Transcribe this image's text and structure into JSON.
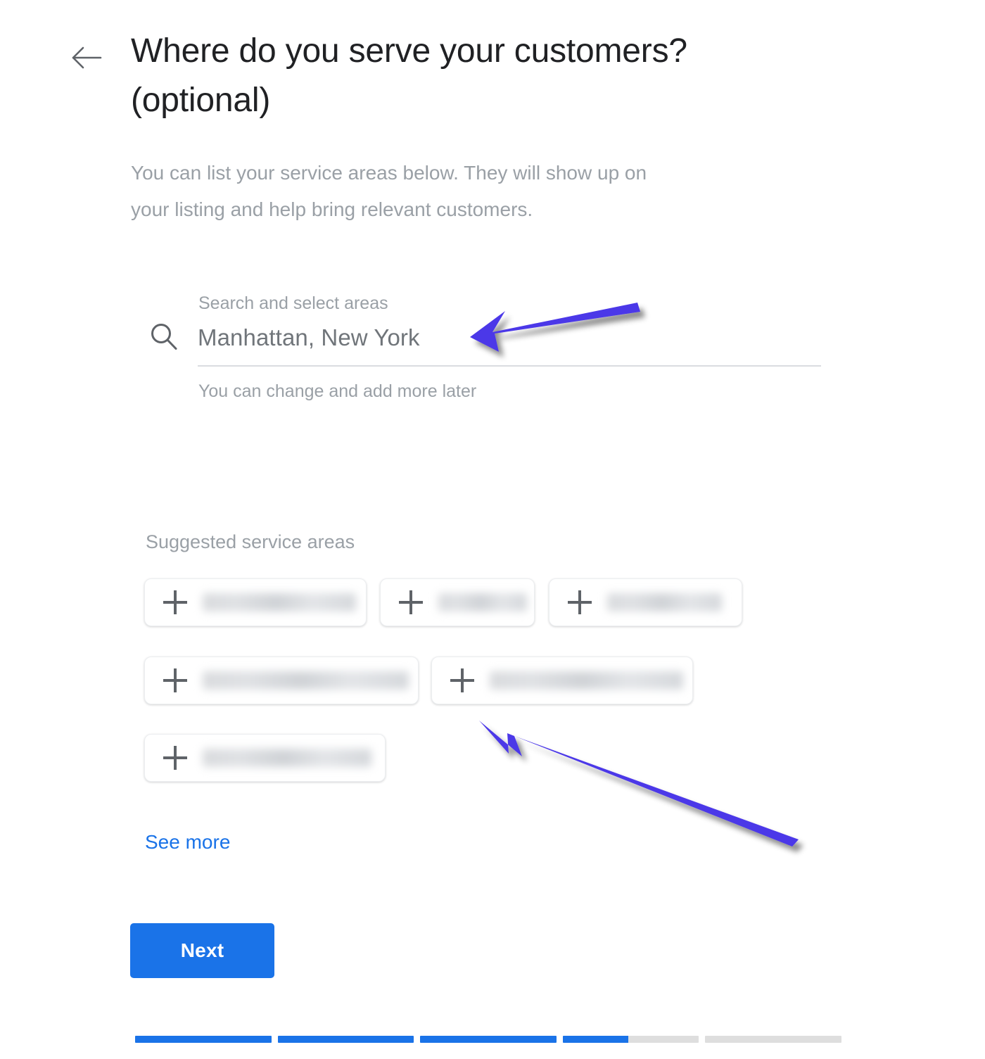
{
  "header": {
    "back_icon": "arrow-left-icon",
    "title": "Where do you serve your customers? (optional)",
    "subtitle": "You can list your service areas below. They will show up on your listing and help bring relevant customers."
  },
  "search": {
    "icon": "search-icon",
    "label": "Search and select areas",
    "value": "Manhattan, New York",
    "placeholder": "Search and select areas",
    "hint": "You can change and add more later"
  },
  "suggested": {
    "title": "Suggested service areas",
    "add_icon": "plus-icon",
    "chips": [
      {
        "label": "",
        "redacted": true,
        "label_width": 218
      },
      {
        "label": "",
        "redacted": true,
        "label_width": 126
      },
      {
        "label": "",
        "redacted": true,
        "label_width": 163
      },
      {
        "label": "",
        "redacted": true,
        "label_width": 293
      },
      {
        "label": "",
        "redacted": true,
        "label_width": 275
      },
      {
        "label": "",
        "redacted": true,
        "label_width": 240
      }
    ],
    "see_more_label": "See more"
  },
  "footer": {
    "next_label": "Next",
    "progress": {
      "segments": [
        100,
        100,
        100,
        48,
        0
      ],
      "active_color": "#1a73e8",
      "track_color": "#dedede"
    }
  },
  "annotations": {
    "color": "#4b37e8",
    "arrows": [
      {
        "name": "arrow-pointing-to-search-field"
      },
      {
        "name": "arrow-pointing-to-suggested-chips"
      }
    ]
  },
  "colors": {
    "accent": "#1a73e8",
    "title_text": "#202124",
    "muted_text": "#9aa0a6",
    "input_text": "#70757a",
    "annotation": "#4b37e8"
  }
}
